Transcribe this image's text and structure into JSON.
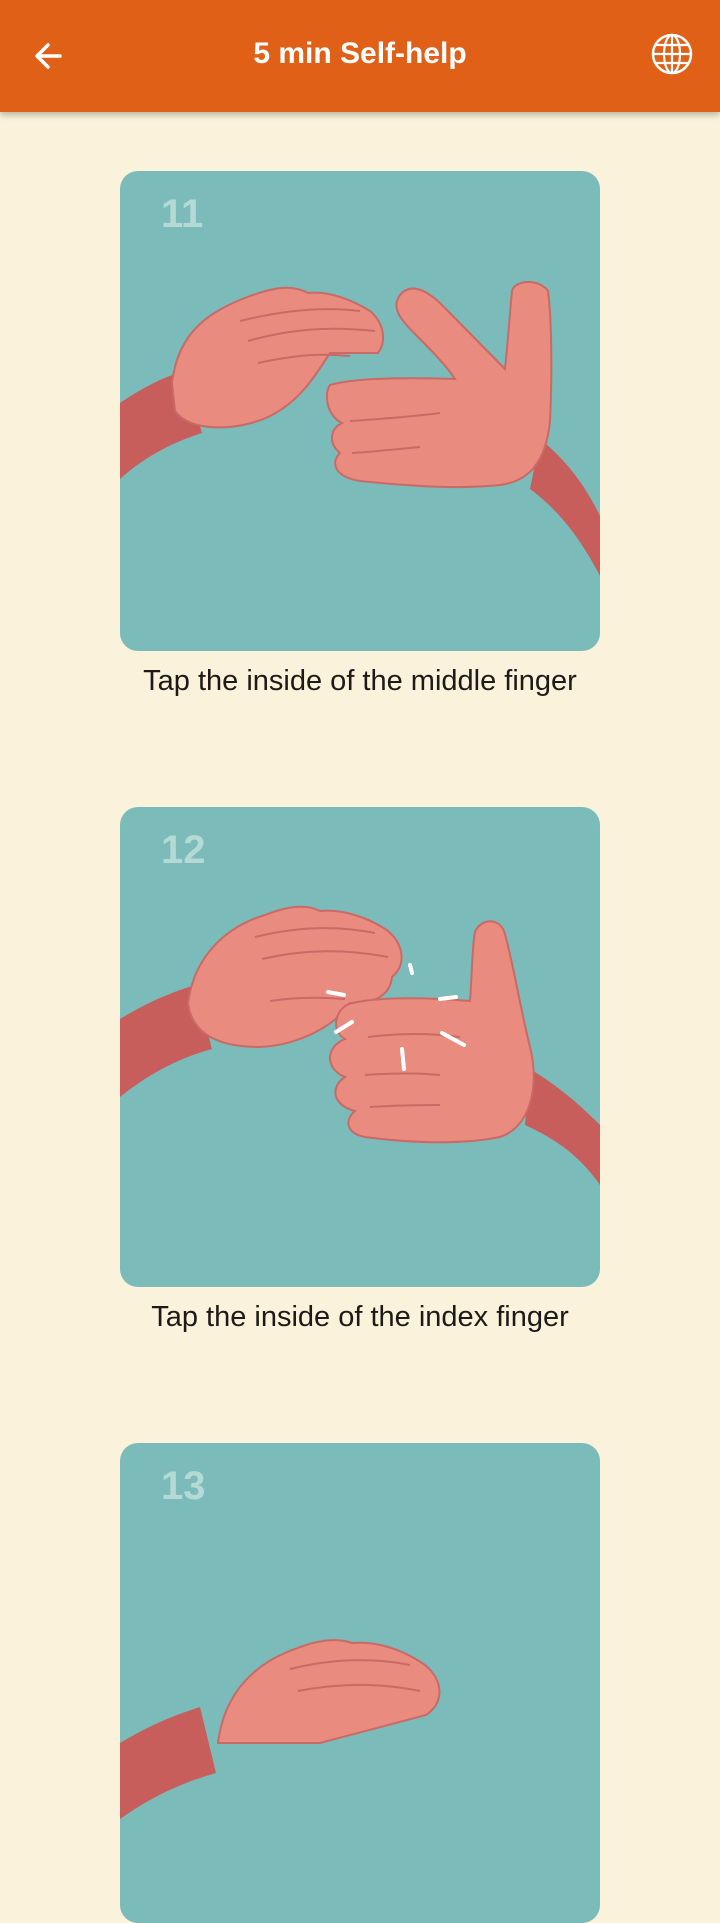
{
  "header": {
    "title": "5 min Self-help",
    "back_icon": "arrow-left-icon",
    "language_icon": "globe-icon"
  },
  "steps": [
    {
      "number": "11",
      "caption": "Tap the inside of the middle finger"
    },
    {
      "number": "12",
      "caption": "Tap the inside of the index finger"
    },
    {
      "number": "13",
      "caption": ""
    }
  ],
  "colors": {
    "header": "#e06018",
    "background": "#faf2db",
    "card": "#7bbbb9",
    "hand": "#ea8b80",
    "sleeve": "#c85e5c"
  }
}
